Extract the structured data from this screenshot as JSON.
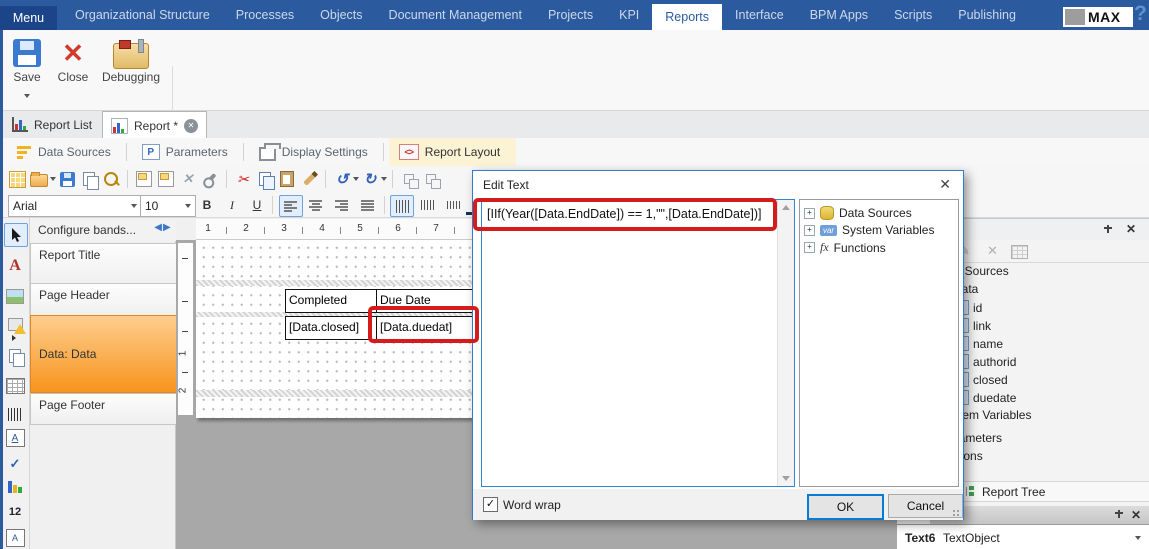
{
  "topbar": {
    "menu_label": "Menu",
    "items": [
      "Organizational Structure",
      "Processes",
      "Objects",
      "Document Management",
      "Projects",
      "KPI",
      "Reports",
      "Interface",
      "BPM Apps",
      "Scripts",
      "Publishing"
    ],
    "logo_text": "MAX",
    "help_label": "?"
  },
  "ribbon": {
    "save_label": "Save",
    "close_label": "Close",
    "debugging_label": "Debugging"
  },
  "doc_tabs": {
    "report_list_label": "Report List",
    "report_label": "Report *"
  },
  "view_tabs": {
    "data_sources_label": "Data Sources",
    "parameters_label": "Parameters",
    "display_settings_label": "Display Settings",
    "report_layout_label": "Report Layout"
  },
  "format_toolbar": {
    "font_name": "Arial",
    "font_size": "10",
    "bold_label": "B",
    "italic_label": "I",
    "underline_label": "U",
    "color_label": "A"
  },
  "bands": {
    "configure_label": "Configure bands...",
    "items": [
      "Report Title",
      "Page Header",
      "Data: Data",
      "Page Footer"
    ]
  },
  "ruler": {
    "h": [
      "1",
      "2",
      "3",
      "4",
      "5",
      "6",
      "7"
    ],
    "v": [
      "1",
      "2"
    ]
  },
  "design": {
    "col1_header": "Completed",
    "col2_header": "Due Date",
    "col1_cell": "[Data.closed]",
    "col2_cell": "[Data.duedat]"
  },
  "dialog": {
    "title": "Edit Text",
    "formula": "[IIf(Year([Data.EndDate]) == 1,\"\",[Data.EndDate])]",
    "tree": [
      {
        "label": "Data Sources",
        "icon": "database-icon"
      },
      {
        "label": "System Variables",
        "icon": "var-icon"
      },
      {
        "label": "Functions",
        "icon": "fx-icon"
      }
    ],
    "var_badge": "var",
    "fx_badge": "fx",
    "word_wrap_label": "Word wrap",
    "ok_label": "OK",
    "cancel_label": "Cancel"
  },
  "right_panel": {
    "tree": [
      "Data Sources",
      "Data",
      "id",
      "link",
      "name",
      "authorid",
      "closed",
      "duedate",
      "System Variables",
      "Parameters",
      "Functions"
    ],
    "report_tree_label": "Report Tree",
    "object_name": "Text6",
    "object_type": "TextObject"
  },
  "icons": {
    "collapse_bands": "◀▶",
    "close": "✕",
    "scissors": "✂",
    "undo": "↺",
    "redo": "↻",
    "check": "✓",
    "plus": "+",
    "pencil": "✎",
    "report_layout_glyph": "<>",
    "parameters_glyph": "P",
    "text_tool_glyph": "A",
    "page_number_glyph": "12"
  },
  "colors": {
    "topbar_blue": "#2b5a9e",
    "band_orange": "#f7941d",
    "annotation_red": "#d51c1c",
    "dialog_border": "#2e7bd0"
  }
}
